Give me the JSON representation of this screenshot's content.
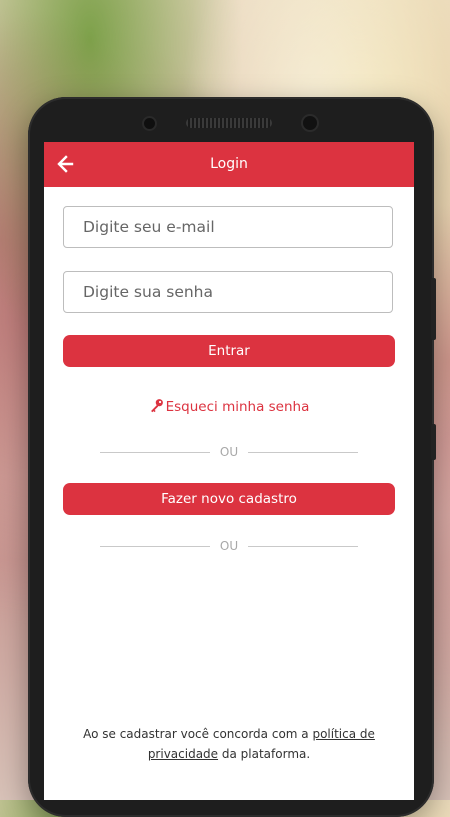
{
  "appbar": {
    "title": "Login"
  },
  "form": {
    "email_placeholder": "Digite seu e-mail",
    "password_placeholder": "Digite sua senha",
    "login_label": "Entrar",
    "forgot_label": "Esqueci minha senha",
    "or_label_1": "OU",
    "register_label": "Fazer novo cadastro",
    "or_label_2": "OU"
  },
  "terms": {
    "line1_prefix": "Ao se cadastrar você concorda com a ",
    "link_part1": "política de",
    "link_part2": "privacidade",
    "line2_suffix": " da plataforma."
  },
  "colors": {
    "accent": "#dc3340",
    "background": "#ffffff",
    "divider": "#c9c9c9"
  },
  "icons": {
    "back": "arrow-left-icon",
    "key": "key-icon"
  }
}
